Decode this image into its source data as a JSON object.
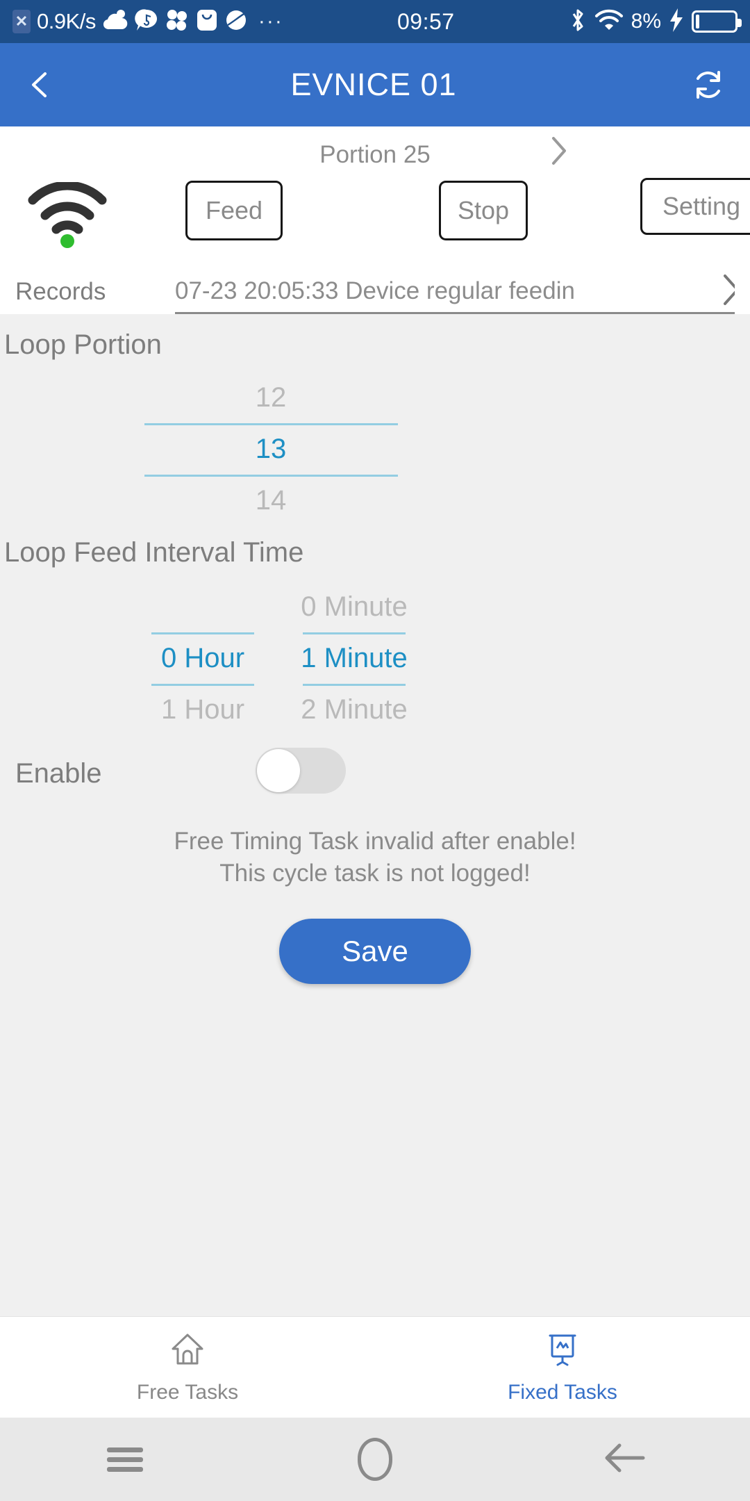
{
  "statusbar": {
    "sim_badge": "✕",
    "network_speed": "0.9K/s",
    "icons": [
      "cloud-icon",
      "music-message-icon",
      "share-flower-icon",
      "bag-icon",
      "planet-icon"
    ],
    "overflow": "···",
    "time": "09:57",
    "bluetooth": "bluetooth-icon",
    "wifi": "wifi-icon",
    "battery_percent": "8%",
    "charging": "charging-bolt-icon"
  },
  "appbar": {
    "back": "back-chevron-icon",
    "title": "EVNICE 01",
    "refresh": "refresh-icon"
  },
  "device": {
    "wifi_status_icon": "wifi-connected-icon",
    "portion_label": "Portion 25",
    "portion_chevron": "chevron-right-icon",
    "feed_label": "Feed",
    "stop_label": "Stop",
    "setting_label": "Setting",
    "records_label": "Records",
    "records_value": "07-23 20:05:33 Device regular feedin",
    "records_chevron": "chevron-right-icon"
  },
  "loop_portion": {
    "title": "Loop Portion",
    "above": "12",
    "selected": "13",
    "below": "14"
  },
  "loop_interval": {
    "title": "Loop Feed Interval Time",
    "hour": {
      "above": "",
      "selected": "0 Hour",
      "below": "1 Hour"
    },
    "minute": {
      "above": "0 Minute",
      "selected": "1 Minute",
      "below": "2 Minute"
    }
  },
  "enable": {
    "label": "Enable",
    "state": "off",
    "warning_line1": "Free Timing Task invalid after enable!",
    "warning_line2": "This cycle task is not logged!"
  },
  "save": {
    "label": "Save"
  },
  "tabs": [
    {
      "label": "Free Tasks",
      "icon": "home-icon",
      "active": false
    },
    {
      "label": "Fixed Tasks",
      "icon": "chart-board-icon",
      "active": true
    }
  ],
  "navbar": {
    "menu": "menu-icon",
    "home": "home-oval-icon",
    "back": "back-arrow-icon"
  },
  "colors": {
    "statusbar_blue": "#1d4e89",
    "appbar_blue": "#3670c8",
    "accent_blue": "#1d8fc4",
    "picker_line": "#93cde2",
    "content_gray": "#f0f0f0",
    "status_dot_green": "#2fbd2f"
  }
}
